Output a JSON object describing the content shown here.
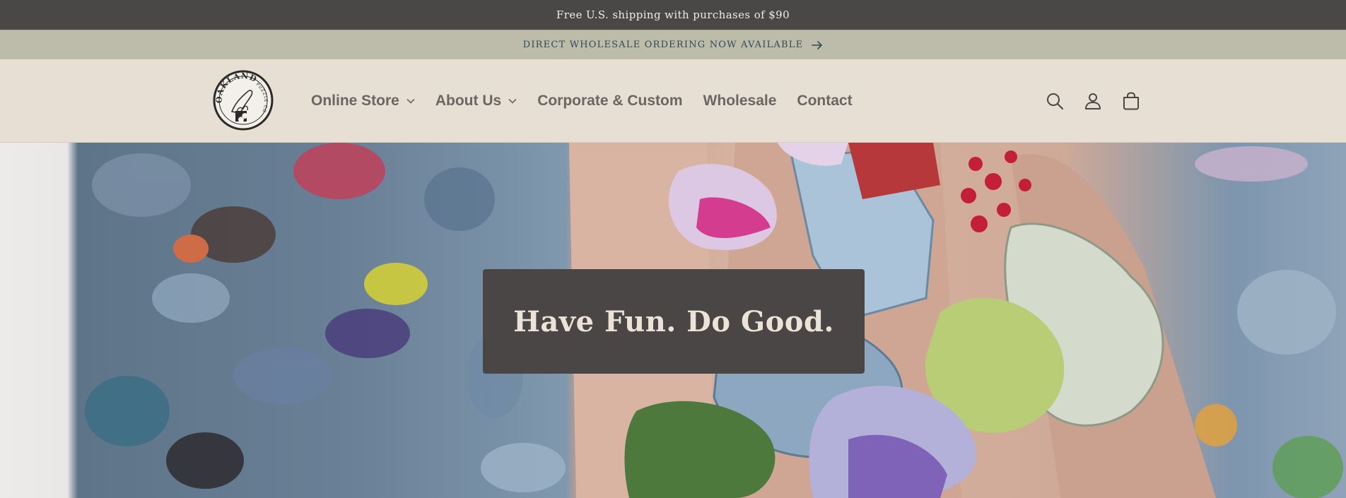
{
  "announcements": {
    "shipping": "Free U.S. shipping with purchases of $90",
    "wholesale": "DIRECT WHOLESALE ORDERING NOW AVAILABLE"
  },
  "logo": {
    "name": "OAKLAND",
    "subtext": "PUZZLE CO"
  },
  "nav": {
    "items": [
      {
        "label": "Online Store",
        "has_dropdown": true
      },
      {
        "label": "About Us",
        "has_dropdown": true
      },
      {
        "label": "Corporate & Custom",
        "has_dropdown": false
      },
      {
        "label": "Wholesale",
        "has_dropdown": false
      },
      {
        "label": "Contact",
        "has_dropdown": false
      }
    ]
  },
  "header_icons": [
    "search-icon",
    "account-icon",
    "cart-icon"
  ],
  "hero": {
    "title": "Have Fun. Do Good."
  },
  "colors": {
    "announcement_bg": "#4a4747",
    "wholesale_bar_bg": "#bdbba9",
    "wholesale_text": "#2f4b55",
    "header_bg": "#e7ded4",
    "nav_text": "#6b6563",
    "hero_box_bg": "#4a4646",
    "hero_text": "#ece3d8"
  }
}
